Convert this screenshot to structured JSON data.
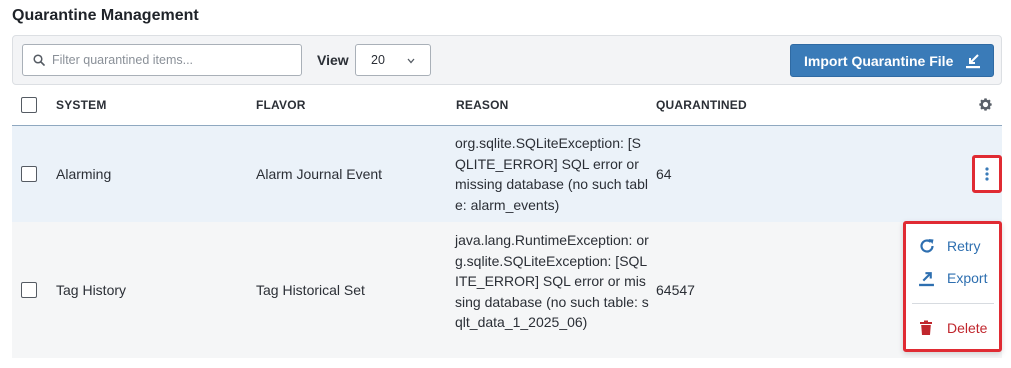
{
  "page": {
    "title": "Quarantine Management"
  },
  "toolbar": {
    "search_placeholder": "Filter quarantined items...",
    "search_value": "",
    "view_label": "View",
    "view_value": "20",
    "import_label": "Import Quarantine File"
  },
  "table": {
    "columns": [
      "SYSTEM",
      "FLAVOR",
      "REASON",
      "QUARANTINED"
    ],
    "rows": [
      {
        "system": "Alarming",
        "flavor": "Alarm Journal Event",
        "reason": "org.sqlite.SQLiteException: [SQLITE_ERROR] SQL error or missing database (no such table: alarm_events)",
        "quarantined": "64"
      },
      {
        "system": "Tag History",
        "flavor": "Tag Historical Set",
        "reason": "java.lang.RuntimeException: org.sqlite.SQLiteException: [SQLITE_ERROR] SQL error or missing database (no such table: sqlt_data_1_2025_06)",
        "quarantined": "64547"
      }
    ]
  },
  "row_menu": {
    "retry": "Retry",
    "export": "Export",
    "delete": "Delete"
  },
  "colors": {
    "accent": "#3a7bb8",
    "highlight_border": "#e02b33",
    "delete": "#c0262d",
    "selected_row": "#ebf2f9"
  },
  "icons": [
    "search-icon",
    "chevron-down-icon",
    "import-icon",
    "gear-icon",
    "kebab-icon",
    "retry-icon",
    "export-icon",
    "trash-icon"
  ]
}
